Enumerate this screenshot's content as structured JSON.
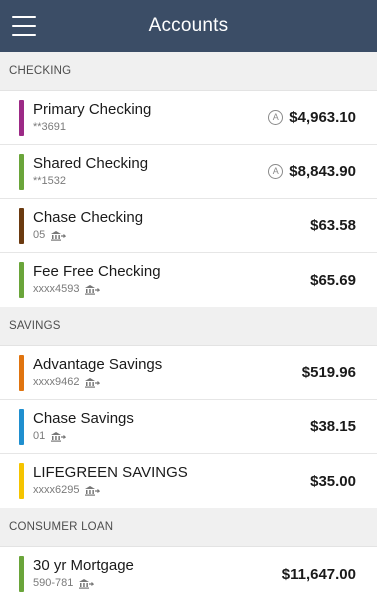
{
  "header": {
    "title": "Accounts"
  },
  "colors": {
    "header_bg": "#3b4d66",
    "purple": "#9c2a86",
    "green": "#6aa53a",
    "brown": "#6b3a10",
    "orange": "#e0740f",
    "blue": "#1f8fcf",
    "yellow": "#f5c400"
  },
  "sections": {
    "checking": {
      "label": "CHECKING",
      "accounts": [
        {
          "name": "Primary Checking",
          "number": "**3691",
          "balance": "$4,963.10",
          "badge": "A",
          "color": "#9c2a86"
        },
        {
          "name": "Shared Checking",
          "number": "**1532",
          "balance": "$8,843.90",
          "badge": "A",
          "color": "#6aa53a"
        },
        {
          "name": "Chase Checking",
          "number": "05",
          "balance": "$63.58",
          "icon": "bank-transfer-icon",
          "color": "#6b3a10"
        },
        {
          "name": "Fee Free Checking",
          "number": "xxxx4593",
          "balance": "$65.69",
          "icon": "bank-transfer-icon",
          "color": "#6aa53a"
        }
      ]
    },
    "savings": {
      "label": "SAVINGS",
      "accounts": [
        {
          "name": "Advantage Savings",
          "number": "xxxx9462",
          "balance": "$519.96",
          "icon": "bank-transfer-icon",
          "color": "#e0740f"
        },
        {
          "name": "Chase Savings",
          "number": "01",
          "balance": "$38.15",
          "icon": "bank-transfer-icon",
          "color": "#1f8fcf"
        },
        {
          "name": "LIFEGREEN SAVINGS",
          "number": "xxxx6295",
          "balance": "$35.00",
          "icon": "bank-transfer-icon",
          "color": "#f5c400"
        }
      ]
    },
    "loan": {
      "label": "CONSUMER LOAN",
      "accounts": [
        {
          "name": "30 yr Mortgage",
          "number": "590-781",
          "balance": "$11,647.00",
          "icon": "bank-transfer-icon",
          "color": "#6aa53a"
        }
      ]
    }
  }
}
